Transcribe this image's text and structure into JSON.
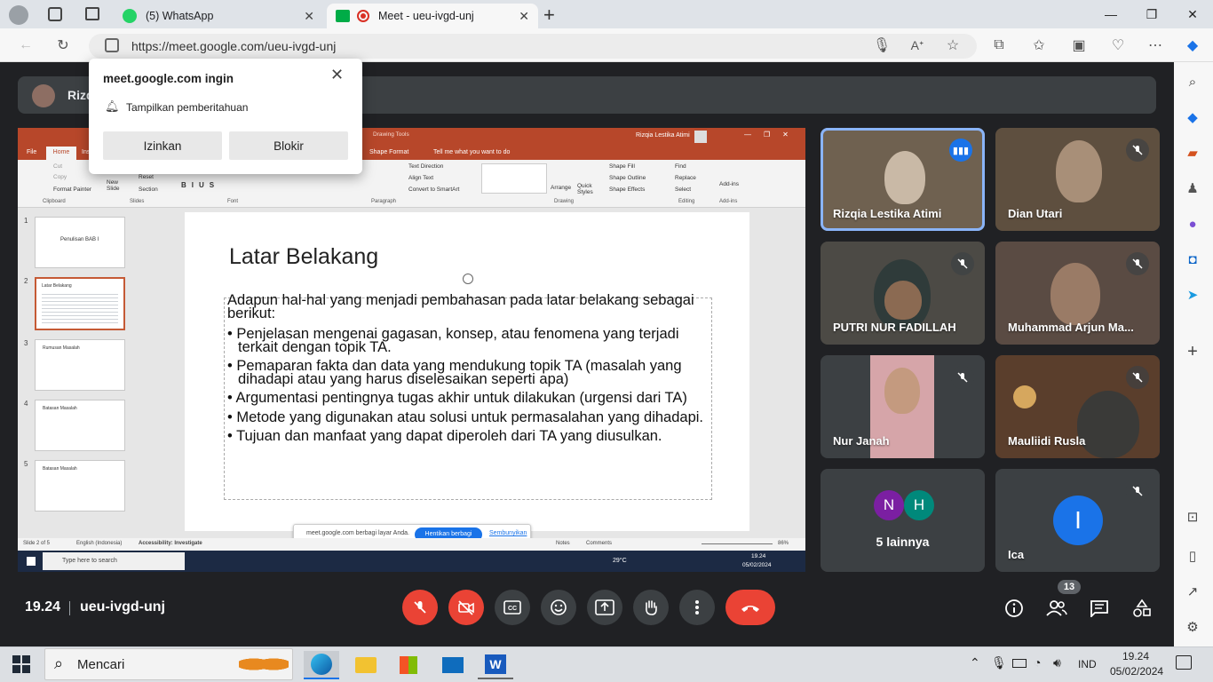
{
  "browser": {
    "tabs": [
      {
        "label": "(5) WhatsApp",
        "active": false
      },
      {
        "label": "Meet - ueu-ivgd-unj",
        "active": true
      }
    ],
    "url": "https://meet.google.com/ueu-ivgd-unj"
  },
  "permission_popup": {
    "title": "meet.google.com ingin",
    "message": "Tampilkan pemberitahuan",
    "allow_label": "Izinkan",
    "block_label": "Blokir"
  },
  "presenter": {
    "name_visible": "Rizq"
  },
  "shared_screen": {
    "ppt_user": "Rizqia Lestika Atimi",
    "ribbon_tabs": [
      "File",
      "Home",
      "Ins"
    ],
    "drawing_tools": "Drawing Tools",
    "shape_format": "Shape Format",
    "tell_me": "Tell me what you want to do",
    "ribbon_groups": [
      "Clipboard",
      "Slides",
      "Font",
      "Paragraph",
      "Drawing",
      "Editing",
      "Add-ins"
    ],
    "ribbon_items": {
      "cut": "Cut",
      "copy": "Copy",
      "format_painter": "Format Painter",
      "new_slide": "New Slide",
      "reset": "Reset",
      "section": "Section",
      "text_direction": "Text Direction",
      "align_text": "Align Text",
      "convert_smartart": "Convert to SmartArt",
      "arrange": "Arrange",
      "quick_styles": "Quick Styles",
      "shape_fill": "Shape Fill",
      "shape_outline": "Shape Outline",
      "shape_effects": "Shape Effects",
      "find": "Find",
      "replace": "Replace",
      "select": "Select",
      "add_ins": "Add-ins"
    },
    "slide_thumbs": [
      {
        "num": "1",
        "title": "Penulisan BAB I"
      },
      {
        "num": "2",
        "title": "Latar Belakang"
      },
      {
        "num": "3",
        "title": "Rumusan Masalah"
      },
      {
        "num": "4",
        "title": "Batasan Masalah"
      },
      {
        "num": "5",
        "title": "Batasan Masalah"
      }
    ],
    "slide": {
      "title": "Latar Belakang",
      "intro": "Adapun hal-hal yang menjadi pembahasan pada latar belakang sebagai berikut:",
      "bullets": [
        "Penjelasan mengenai gagasan, konsep, atau fenomena yang terjadi terkait dengan topik TA.",
        "Pemaparan fakta dan data yang mendukung topik TA (masalah yang dihadapi atau yang harus diselesaikan seperti apa)",
        "Argumentasi pentingnya tugas akhir untuk dilakukan (urgensi dari TA)",
        "Metode yang digunakan atau solusi untuk permasalahan yang dihadapi.",
        "Tujuan dan manfaat yang dapat diperoleh dari TA yang diusulkan."
      ]
    },
    "status": {
      "slide_of": "Slide 2 of 5",
      "language": "English (Indonesia)",
      "accessibility": "Accessibility: Investigate",
      "notes": "Notes",
      "comments": "Comments",
      "zoom": "86%"
    },
    "share_banner": {
      "text": "meet.google.com berbagi layar Anda.",
      "stop_label": "Hentikan berbagi",
      "hide_label": "Sembunyikan"
    },
    "inner_taskbar": {
      "search": "Type here to search",
      "weather": "29°C",
      "time": "19.24",
      "date": "05/02/2024"
    }
  },
  "participants": [
    {
      "name": "Rizqia Lestika Atimi",
      "speaking": true,
      "muted": false
    },
    {
      "name": "Dian Utari",
      "speaking": false,
      "muted": true
    },
    {
      "name": "PUTRI NUR FADILLAH",
      "speaking": false,
      "muted": true
    },
    {
      "name": "Muhammad Arjun Ma...",
      "speaking": false,
      "muted": true
    },
    {
      "name": "Nur Janah",
      "speaking": false,
      "muted": true
    },
    {
      "name": "Mauliidi Rusla",
      "speaking": false,
      "muted": true
    }
  ],
  "others_tile": {
    "label": "5 lainnya",
    "initials": [
      "N",
      "H"
    ],
    "colors": [
      "#7b1fa2",
      "#00897b"
    ]
  },
  "ica_tile": {
    "name": "Ica",
    "initial": "I",
    "color": "#1a73e8"
  },
  "meet_footer": {
    "time": "19.24",
    "meeting_code": "ueu-ivgd-unj",
    "participant_count": "13"
  },
  "taskbar": {
    "search": "Mencari",
    "language": "IND",
    "time": "19.24",
    "date": "05/02/2024"
  }
}
